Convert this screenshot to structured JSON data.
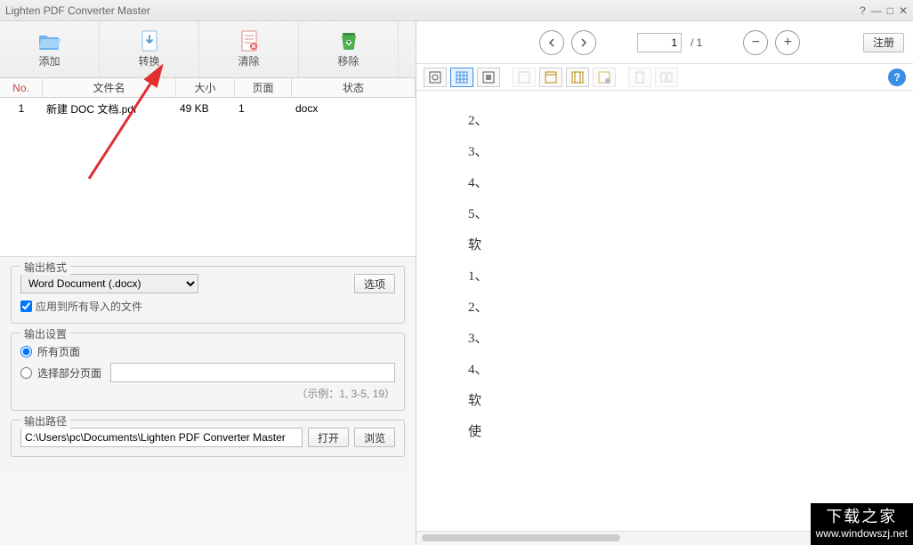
{
  "window": {
    "title": "Lighten PDF Converter Master"
  },
  "toolbar": {
    "add": "添加",
    "convert": "转换",
    "clear": "清除",
    "remove": "移除"
  },
  "table": {
    "headers": {
      "no": "No.",
      "name": "文件名",
      "size": "大小",
      "page": "页面",
      "status": "状态"
    },
    "rows": [
      {
        "no": "1",
        "name": "新建 DOC 文档.pdf",
        "size": "49 KB",
        "page": "1",
        "status": "docx"
      }
    ]
  },
  "output_format": {
    "legend": "输出格式",
    "selected": "Word Document (.docx)",
    "options_btn": "选项",
    "apply_all": "应用到所有导入的文件",
    "apply_all_checked": true
  },
  "output_settings": {
    "legend": "输出设置",
    "all_pages": "所有页面",
    "select_pages": "选择部分页面",
    "range_value": "",
    "example": "（示例：1, 3-5, 19）",
    "selected_radio": "all"
  },
  "output_path": {
    "legend": "输出路径",
    "value": "C:\\Users\\pc\\Documents\\Lighten PDF Converter Master",
    "open": "打开",
    "browse": "浏览"
  },
  "nav": {
    "page_current": "1",
    "page_total": "/ 1",
    "register": "注册"
  },
  "preview": {
    "lines": [
      "2、",
      "3、",
      "4、",
      "5、",
      "软",
      "1、",
      "2、",
      "3、",
      "4、",
      "软",
      "使"
    ]
  },
  "watermark": {
    "brand": "下载之家",
    "url": "www.windowszj.net"
  }
}
